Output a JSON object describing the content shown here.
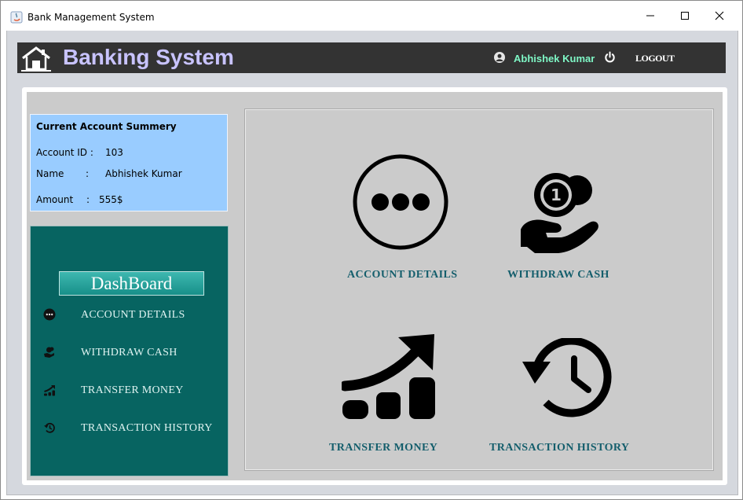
{
  "window": {
    "title": "Bank Management System"
  },
  "header": {
    "app_title": "Banking System",
    "user_name": "Abhishek Kumar",
    "logout_label": "LOGOUT"
  },
  "summary": {
    "title": "Current Account Summery",
    "account_id_label": "Account ID :",
    "account_id_value": "103",
    "name_label": "Name",
    "name_colon": ":",
    "name_value": "Abhishek Kumar",
    "amount_label": "Amount",
    "amount_colon": ":",
    "amount_value": "555$"
  },
  "sidebar": {
    "dashboard_label": "DashBoard",
    "items": [
      {
        "label": "ACCOUNT DETAILS",
        "icon": "ellipsis-circle-icon"
      },
      {
        "label": "WITHDRAW CASH",
        "icon": "coin-hand-icon"
      },
      {
        "label": "TRANSFER MONEY",
        "icon": "growth-chart-icon"
      },
      {
        "label": "TRANSACTION HISTORY",
        "icon": "history-icon"
      }
    ]
  },
  "tiles": [
    {
      "label": "ACCOUNT DETAILS",
      "icon": "ellipsis-circle-icon"
    },
    {
      "label": "WITHDRAW CASH",
      "icon": "coin-hand-icon"
    },
    {
      "label": "TRANSFER MONEY",
      "icon": "growth-chart-icon"
    },
    {
      "label": "TRANSACTION HISTORY",
      "icon": "history-icon"
    }
  ],
  "colors": {
    "header_bg": "#333333",
    "title_text": "#c8c3ff",
    "user_text": "#7ff7c6",
    "summary_bg": "#99ccff",
    "sidebar_bg": "#076461",
    "tile_label": "#145e6c",
    "panel_bg": "#cbcbcb"
  }
}
